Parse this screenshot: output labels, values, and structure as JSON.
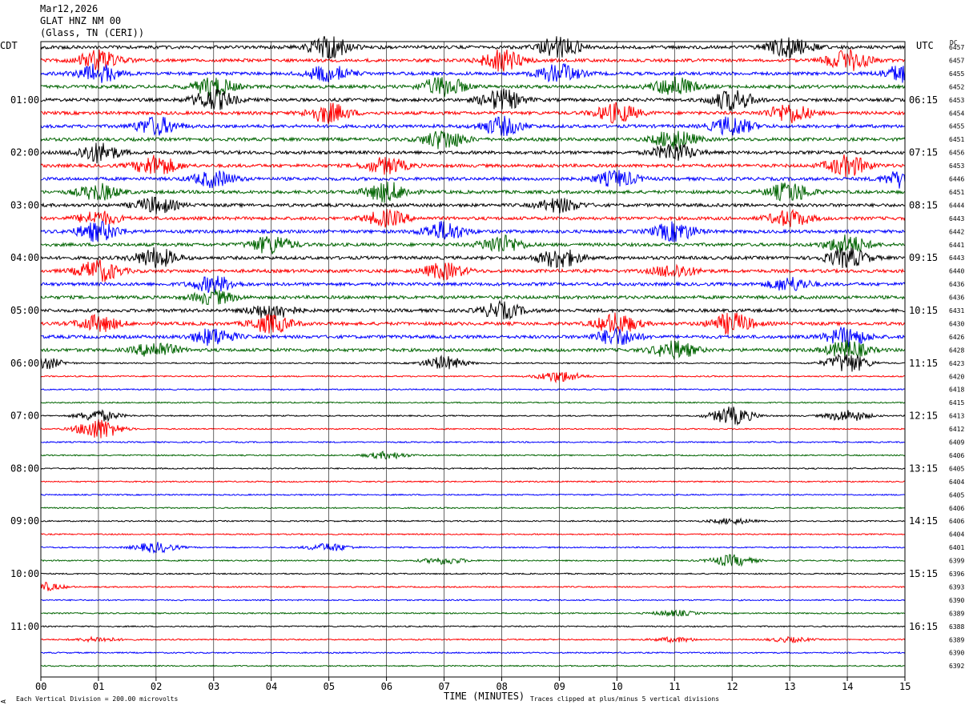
{
  "header": {
    "date": "Mar12,2026",
    "station": "GLAT HNZ NM 00",
    "location": "(Glass, TN (CERI))"
  },
  "labels": {
    "left_zone": "CDT",
    "right_zone": "UTC",
    "dc_header": "DC",
    "x_axis_title": "TIME (MINUTES)",
    "footer_left": "Each Vertical Division =  200.00 microvolts",
    "footer_right": "Traces clipped at plus/minus 5 vertical divisions",
    "corner_mark": "A"
  },
  "colors": {
    "trace_cycle": [
      "#000000",
      "#ff0000",
      "#0000ff",
      "#006400"
    ],
    "grid": "#000000",
    "background": "#ffffff"
  },
  "chart_data": {
    "type": "line",
    "description_kind": "helicorder",
    "x_unit": "minutes",
    "xlim": [
      0,
      15
    ],
    "x_ticks": [
      "00",
      "01",
      "02",
      "03",
      "04",
      "05",
      "06",
      "07",
      "08",
      "09",
      "10",
      "11",
      "12",
      "13",
      "14",
      "15"
    ],
    "traces_per_hour": 4,
    "trace_count": 48,
    "left_hour_labels": [
      "01:00",
      "02:00",
      "03:00",
      "04:00",
      "05:00",
      "06:00",
      "07:00",
      "08:00",
      "09:00",
      "10:00",
      "11:00"
    ],
    "right_hour_labels": [
      "06:15",
      "07:15",
      "08:15",
      "09:15",
      "10:15",
      "11:15",
      "12:15",
      "13:15",
      "14:15",
      "15:15",
      "16:15"
    ],
    "dc_offsets": [
      "6457",
      "6457",
      "6455",
      "6452",
      "6453",
      "6454",
      "6455",
      "6451",
      "6456",
      "6453",
      "6446",
      "6451",
      "6444",
      "6443",
      "6442",
      "6441",
      "6443",
      "6440",
      "6436",
      "6436",
      "6431",
      "6430",
      "6426",
      "6428",
      "6423",
      "6420",
      "6418",
      "6415",
      "6413",
      "6412",
      "6409",
      "6406",
      "6405",
      "6404",
      "6405",
      "6406",
      "6406",
      "6404",
      "6401",
      "6399",
      "6396",
      "6393",
      "6390",
      "6389",
      "6388",
      "6389",
      "6390",
      "6392"
    ],
    "activity": [
      [
        0,
        5,
        0.95
      ],
      [
        0,
        9,
        0.95
      ],
      [
        0,
        13,
        0.95
      ],
      [
        1,
        1,
        0.9
      ],
      [
        1,
        8,
        0.9
      ],
      [
        1,
        14,
        0.9
      ],
      [
        2,
        1,
        0.8
      ],
      [
        2,
        5,
        0.8
      ],
      [
        2,
        9,
        0.8
      ],
      [
        2,
        15,
        0.8
      ],
      [
        3,
        3,
        0.8
      ],
      [
        3,
        7,
        0.9
      ],
      [
        3,
        11,
        0.85
      ],
      [
        4,
        3,
        0.9
      ],
      [
        4,
        8,
        0.9
      ],
      [
        4,
        12,
        0.9
      ],
      [
        5,
        5,
        0.85
      ],
      [
        5,
        10,
        0.85
      ],
      [
        5,
        13,
        0.85
      ],
      [
        6,
        2,
        0.8
      ],
      [
        6,
        8,
        0.8
      ],
      [
        6,
        12,
        0.8
      ],
      [
        7,
        7,
        0.85
      ],
      [
        7,
        11,
        0.85
      ],
      [
        8,
        1,
        0.85
      ],
      [
        8,
        11,
        0.8
      ],
      [
        9,
        2,
        0.9
      ],
      [
        9,
        6,
        0.7
      ],
      [
        9,
        14,
        0.9
      ],
      [
        10,
        3,
        0.7
      ],
      [
        10,
        10,
        0.7
      ],
      [
        10,
        15,
        0.8
      ],
      [
        11,
        1,
        0.7
      ],
      [
        11,
        6,
        0.85
      ],
      [
        11,
        13,
        0.85
      ],
      [
        12,
        2,
        0.7
      ],
      [
        12,
        9,
        0.6
      ],
      [
        13,
        1,
        0.6
      ],
      [
        13,
        6,
        0.7
      ],
      [
        13,
        13,
        0.7
      ],
      [
        14,
        1,
        0.85
      ],
      [
        14,
        7,
        0.85
      ],
      [
        14,
        11,
        0.85
      ],
      [
        15,
        4,
        0.8
      ],
      [
        15,
        8,
        0.8
      ],
      [
        15,
        14,
        0.8
      ],
      [
        16,
        2,
        0.85
      ],
      [
        16,
        9,
        0.85
      ],
      [
        16,
        14,
        0.85
      ],
      [
        17,
        1,
        0.95
      ],
      [
        17,
        7,
        0.7
      ],
      [
        17,
        11,
        0.6
      ],
      [
        18,
        3,
        0.7
      ],
      [
        18,
        13,
        0.6
      ],
      [
        19,
        3,
        0.6
      ],
      [
        20,
        4,
        0.8
      ],
      [
        20,
        8,
        0.7
      ],
      [
        21,
        1,
        0.7
      ],
      [
        21,
        4,
        0.8
      ],
      [
        21,
        10,
        0.9
      ],
      [
        21,
        12,
        0.9
      ],
      [
        22,
        3,
        0.75
      ],
      [
        22,
        10,
        0.75
      ],
      [
        22,
        14,
        0.8
      ],
      [
        23,
        2,
        0.7
      ],
      [
        23,
        11,
        0.8
      ],
      [
        23,
        14,
        0.8
      ],
      [
        24,
        0,
        0.6
      ],
      [
        24,
        7,
        0.6
      ],
      [
        24,
        14,
        0.9
      ],
      [
        25,
        9,
        0.5
      ],
      [
        28,
        1,
        0.5
      ],
      [
        28,
        12,
        0.8
      ],
      [
        28,
        14,
        0.5
      ],
      [
        29,
        1,
        0.95
      ],
      [
        31,
        6,
        0.3
      ],
      [
        36,
        12,
        0.25
      ],
      [
        38,
        2,
        0.45
      ],
      [
        38,
        5,
        0.35
      ],
      [
        39,
        7,
        0.3
      ],
      [
        39,
        12,
        0.5
      ],
      [
        41,
        0,
        0.4
      ],
      [
        43,
        11,
        0.25
      ],
      [
        45,
        1,
        0.2
      ],
      [
        45,
        11,
        0.2
      ],
      [
        45,
        13,
        0.2
      ]
    ]
  }
}
